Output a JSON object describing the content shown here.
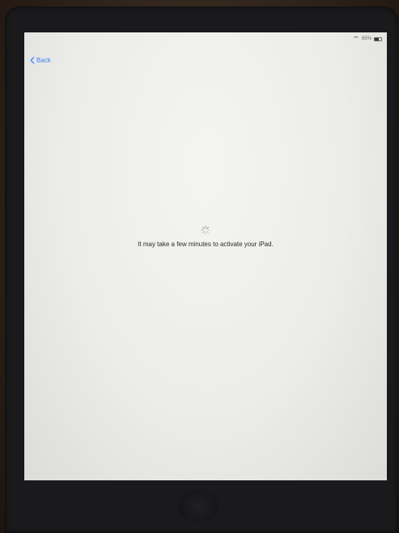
{
  "status_bar": {
    "battery_text": "65%",
    "battery_level": 0.65,
    "wifi_icon": "wifi-icon",
    "battery_icon": "battery-icon"
  },
  "nav": {
    "back_label": "Back",
    "back_icon": "chevron-left-icon",
    "accent_color": "#3b82f6"
  },
  "main": {
    "loading_icon": "spinner-icon",
    "message": "It may take a few minutes to activate your iPad."
  }
}
